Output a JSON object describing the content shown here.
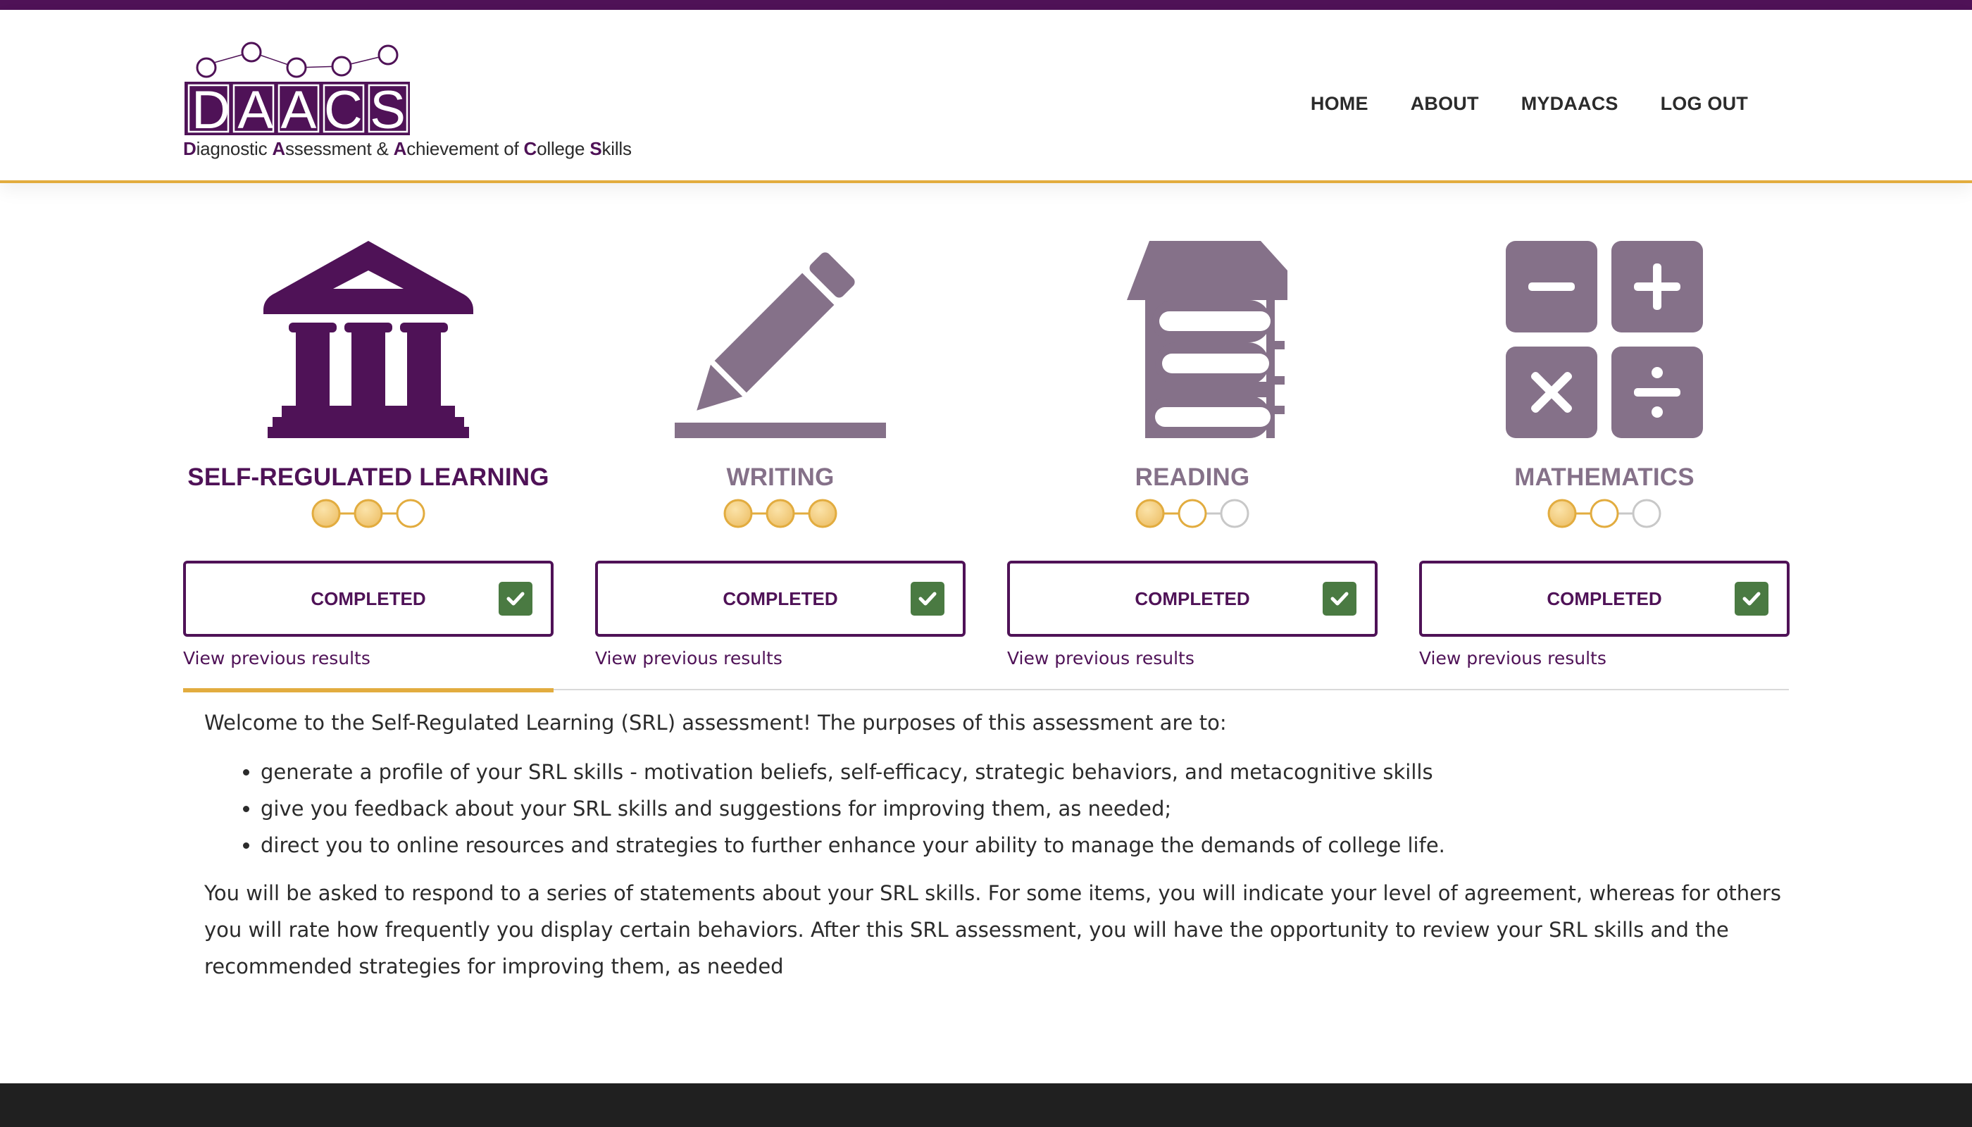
{
  "logo": {
    "text": "DAACS",
    "tagline": [
      {
        "t": "D",
        "accent": true
      },
      {
        "t": "iagnostic ",
        "accent": false
      },
      {
        "t": "A",
        "accent": true
      },
      {
        "t": "ssessment & ",
        "accent": false
      },
      {
        "t": "A",
        "accent": true
      },
      {
        "t": "chievement of ",
        "accent": false
      },
      {
        "t": "C",
        "accent": true
      },
      {
        "t": "ollege ",
        "accent": false
      },
      {
        "t": "S",
        "accent": true
      },
      {
        "t": "kills",
        "accent": false
      }
    ]
  },
  "nav": {
    "home": "HOME",
    "about": "ABOUT",
    "mydaacs": "MYDAACS",
    "logout": "LOG OUT"
  },
  "cards": [
    {
      "title": "SELF-REGULATED LEARNING",
      "icon": "institution-icon",
      "active": true,
      "progress": 3,
      "status": "COMPLETED",
      "link": "View previous results"
    },
    {
      "title": "WRITING",
      "icon": "pencil-icon",
      "active": false,
      "progress": 3,
      "status": "COMPLETED",
      "link": "View previous results"
    },
    {
      "title": "READING",
      "icon": "books-icon",
      "active": false,
      "progress": 2,
      "status": "COMPLETED",
      "link": "View previous results"
    },
    {
      "title": "MATHEMATICS",
      "icon": "calculator-icon",
      "active": false,
      "progress": 2,
      "status": "COMPLETED",
      "link": "View previous results"
    }
  ],
  "content": {
    "intro": "Welcome to the Self-Regulated Learning (SRL) assessment! The purposes of this assessment are to:",
    "bullets": [
      "generate a profile of your SRL skills - motivation beliefs, self-efficacy, strategic behaviors, and metacognitive skills",
      "give you feedback about your SRL skills and suggestions for improving them, as needed;",
      "direct you to online resources and strategies to further enhance your ability to manage the demands of college life."
    ],
    "outro": "You will be asked to respond to a series of statements about your SRL skills. For some items, you will indicate your level of agreement, whereas for others you will rate how frequently you display certain behaviors. After this SRL assessment, you will have the opportunity to review your SRL skills and the recommended strategies for improving them, as needed"
  },
  "colors": {
    "brand": "#4f1257",
    "brand_muted": "#857189",
    "accent": "#e2ac3f",
    "success": "#4a7a42",
    "inactive_dot": "#c8c8c8",
    "footer": "#202020"
  }
}
